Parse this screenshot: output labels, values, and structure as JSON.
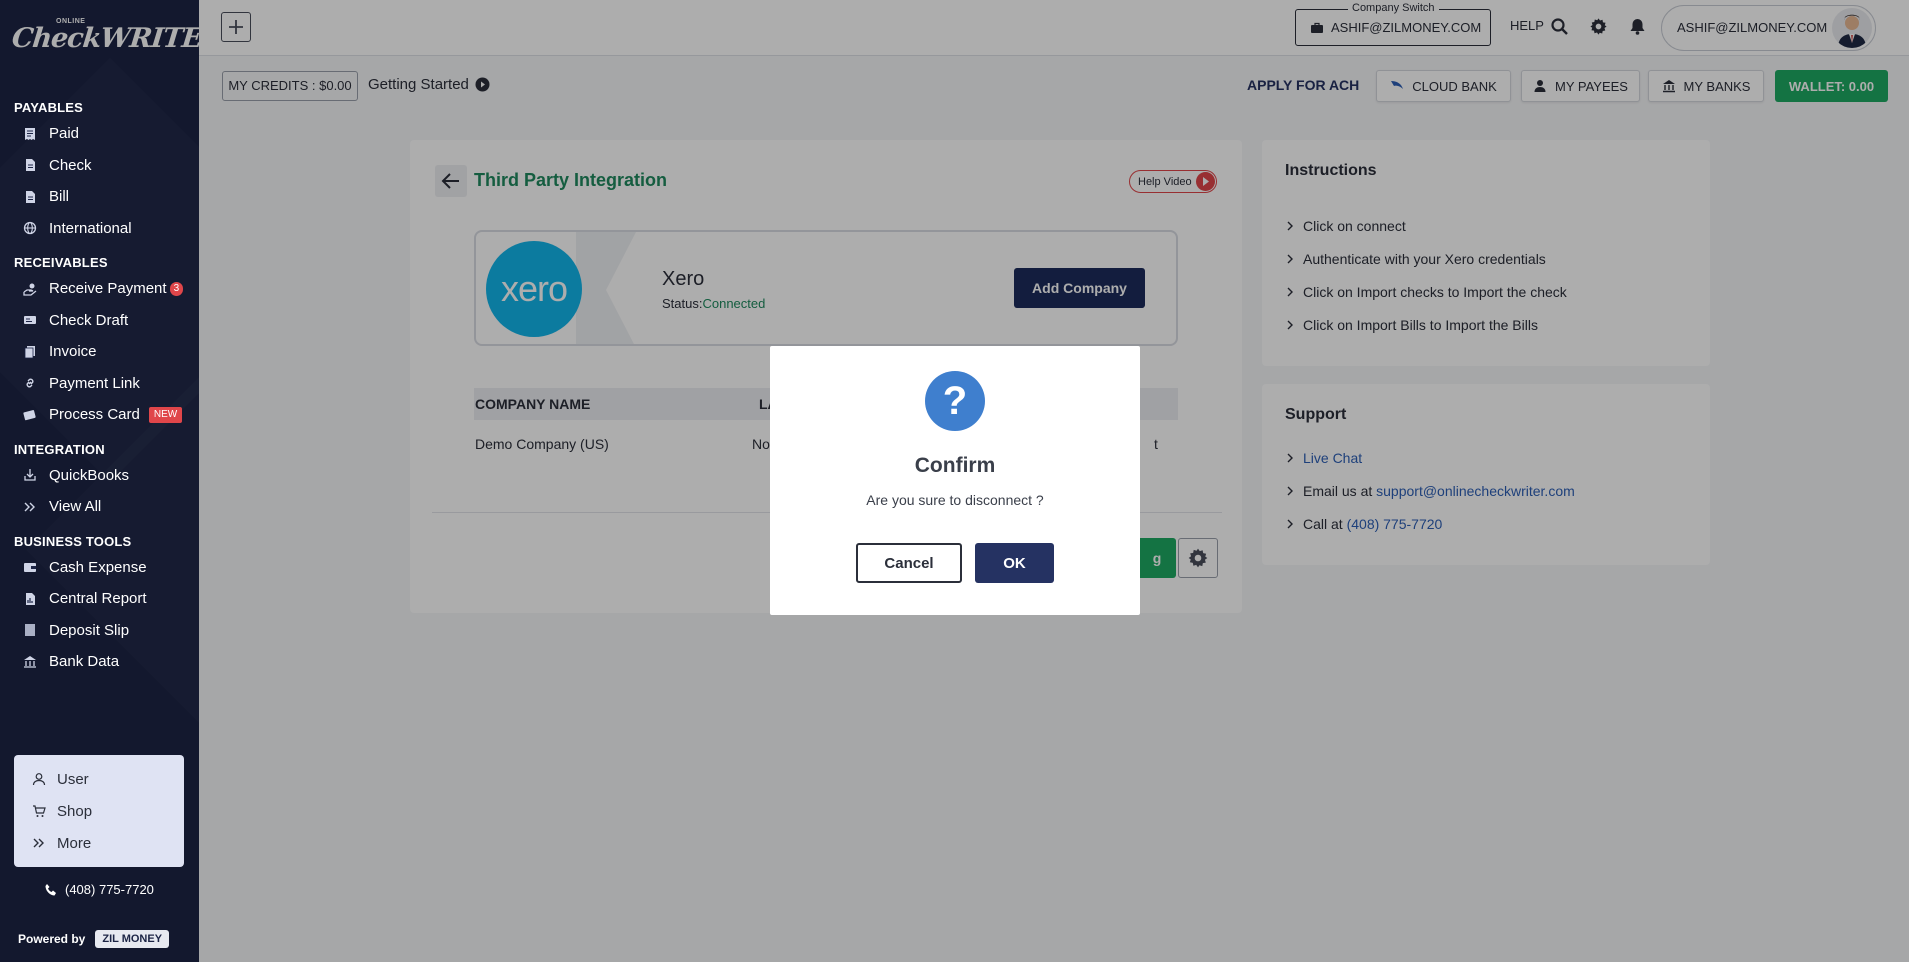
{
  "brand": {
    "online": "ONLINE",
    "name": "CheckWRITER"
  },
  "sidebar": {
    "sections": [
      {
        "title": "PAYABLES",
        "items": [
          {
            "label": "Paid",
            "icon": "receipt-icon"
          },
          {
            "label": "Check",
            "icon": "document-icon"
          },
          {
            "label": "Bill",
            "icon": "document-icon"
          },
          {
            "label": "International",
            "icon": "globe-icon"
          }
        ]
      },
      {
        "title": "RECEIVABLES",
        "items": [
          {
            "label": "Receive Payment",
            "icon": "hand-money-icon",
            "badge": "3"
          },
          {
            "label": "Check Draft",
            "icon": "check-draft-icon"
          },
          {
            "label": "Invoice",
            "icon": "invoice-icon"
          },
          {
            "label": "Payment Link",
            "icon": "link-icon"
          },
          {
            "label": "Process Card",
            "icon": "card-icon",
            "tag": "NEW"
          }
        ]
      },
      {
        "title": "INTEGRATION",
        "items": [
          {
            "label": "QuickBooks",
            "icon": "import-icon"
          },
          {
            "label": "View All",
            "icon": "double-chevron-icon"
          }
        ]
      },
      {
        "title": "BUSINESS TOOLS",
        "items": [
          {
            "label": "Cash Expense",
            "icon": "wallet-icon"
          },
          {
            "label": "Central Report",
            "icon": "report-icon"
          },
          {
            "label": "Deposit Slip",
            "icon": "slip-icon"
          },
          {
            "label": "Bank Data",
            "icon": "bank-icon"
          }
        ]
      }
    ],
    "bottom": [
      {
        "label": "User",
        "icon": "user-icon"
      },
      {
        "label": "Shop",
        "icon": "cart-icon"
      },
      {
        "label": "More",
        "icon": "double-chevron-icon"
      }
    ],
    "phone": "(408) 775-7720",
    "powered_by": "Powered by",
    "powered_brand": "ZIL MONEY"
  },
  "topbar": {
    "company_switch_label": "Company Switch",
    "company": "ASHIF@ZILMONEY.COM",
    "help": "HELP",
    "user": "ASHIF@ZILMONEY.COM"
  },
  "subbar": {
    "credits": "MY CREDITS : $0.00",
    "getting_started": "Getting Started",
    "apply_ach": "APPLY FOR ACH",
    "cloud_bank": "CLOUD BANK",
    "my_payees": "MY PAYEES",
    "my_banks": "MY BANKS",
    "wallet": "WALLET: 0.00"
  },
  "main": {
    "title": "Third Party Integration",
    "help_video": "Help Video",
    "integration": {
      "logo_text": "xero",
      "name": "Xero",
      "status_label": "Status:",
      "status": "Connected"
    },
    "add_company": "Add Company",
    "table": {
      "headers": [
        "COMPANY NAME",
        "LAS"
      ],
      "rows": [
        [
          "Demo Company (US)",
          "Nov",
          "t"
        ]
      ]
    },
    "sync_partial": "g"
  },
  "instructions": {
    "title": "Instructions",
    "items": [
      "Click on connect",
      "Authenticate with your Xero credentials",
      "Click on Import checks to Import the check",
      "Click on Import Bills to Import the Bills"
    ]
  },
  "support": {
    "title": "Support",
    "live_chat": "Live Chat",
    "email_prefix": "Email us at",
    "email": "support@onlinecheckwriter.com",
    "call_prefix": "Call at",
    "phone": "(408) 775-7720"
  },
  "modal": {
    "icon": "?",
    "title": "Confirm",
    "message": "Are you sure to disconnect ?",
    "cancel": "Cancel",
    "ok": "OK"
  },
  "colors": {
    "sidebar": "#1c2445",
    "accent_green": "#1eaa63",
    "title_green": "#1f8a5f",
    "navy": "#253262",
    "xero_blue": "#13b5ea",
    "badge_red": "#e0464a"
  }
}
